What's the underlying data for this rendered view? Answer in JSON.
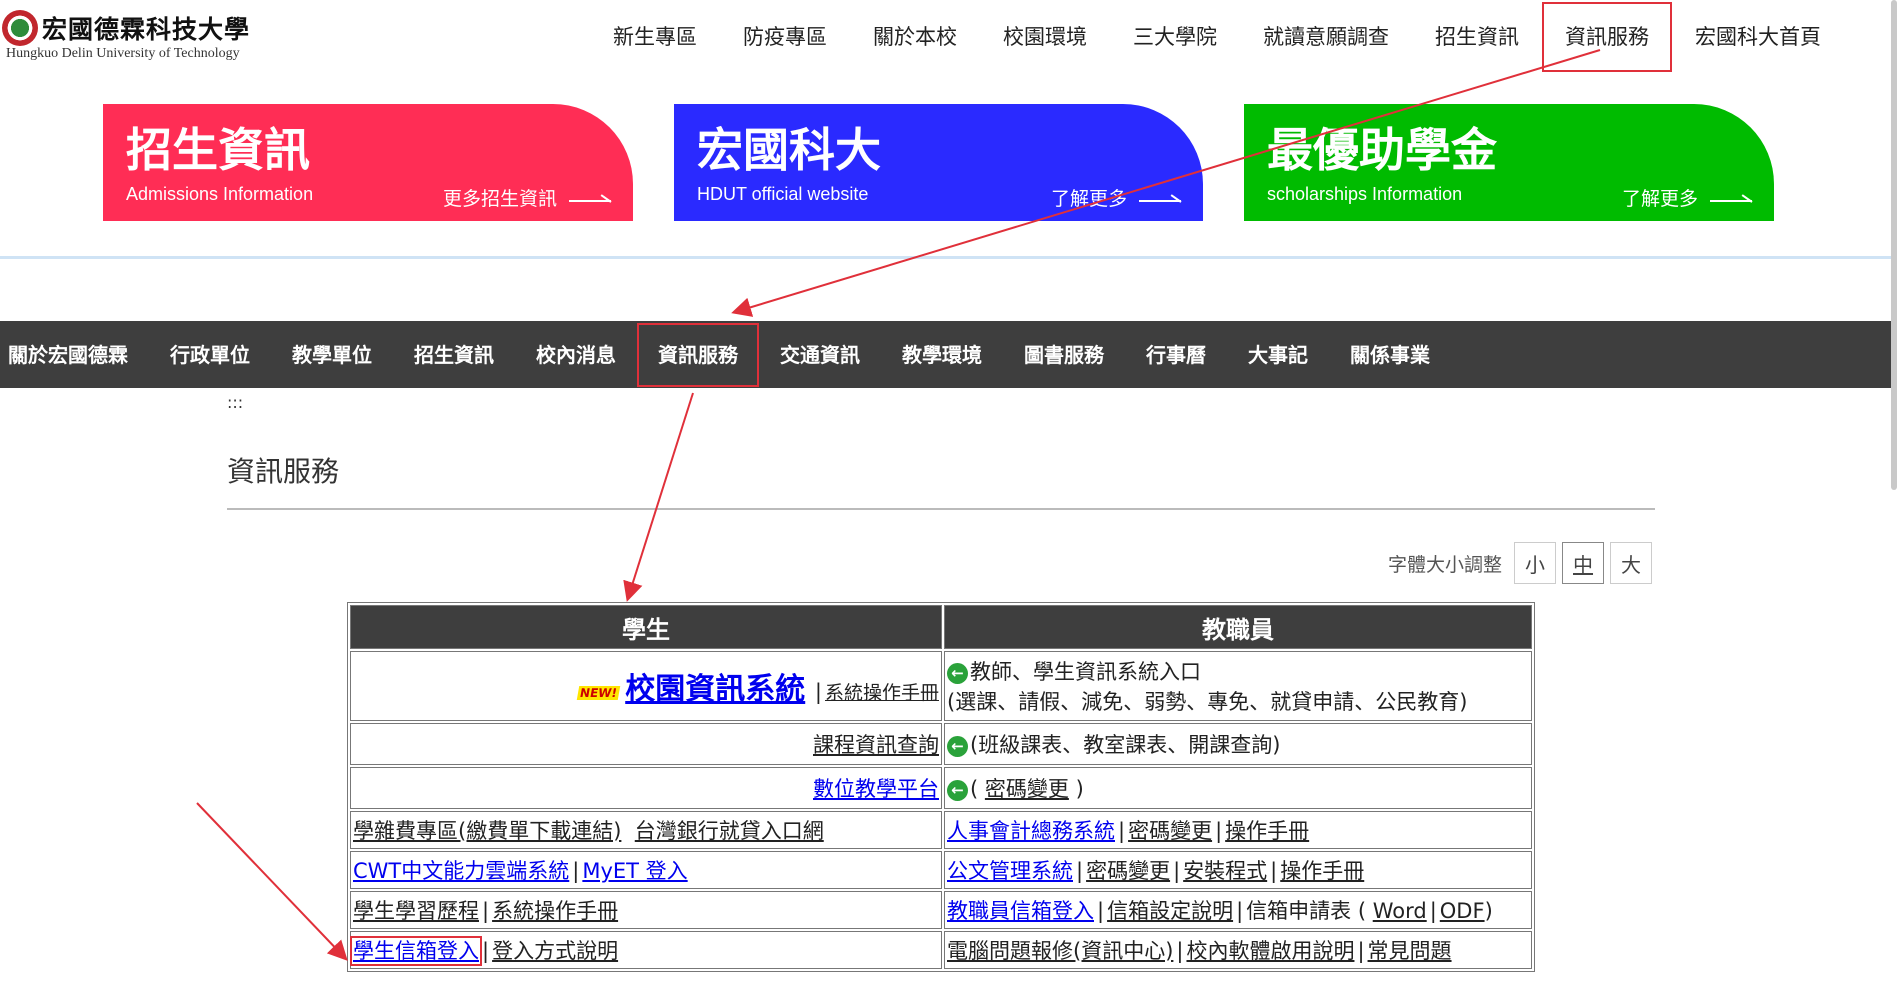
{
  "logo": {
    "name_cn": "宏國德霖科技大學",
    "name_en": "Hungkuo Delin University of Technology"
  },
  "top_nav": [
    "新生專區",
    "防疫專區",
    "關於本校",
    "校園環境",
    "三大學院",
    "就讀意願調查",
    "招生資訊",
    "資訊服務",
    "宏國科大首頁"
  ],
  "banners": [
    {
      "title": "招生資訊",
      "subtitle": "Admissions Information",
      "more": "更多招生資訊",
      "color": "#ff2d55"
    },
    {
      "title": "宏國科大",
      "subtitle": "HDUT official website",
      "more": "了解更多",
      "color": "#2a2aff"
    },
    {
      "title": "最優助學金",
      "subtitle": "scholarships Information",
      "more": "了解更多",
      "color": "#00bb00"
    }
  ],
  "gray_nav": [
    "關於宏國德霖",
    "行政單位",
    "教學單位",
    "招生資訊",
    "校內消息",
    "資訊服務",
    "交通資訊",
    "教學環境",
    "圖書服務",
    "行事曆",
    "大事記",
    "關係事業"
  ],
  "crumb": ":::",
  "page_title": "資訊服務",
  "font_size": {
    "label": "字體大小調整",
    "small": "小",
    "medium": "中",
    "large": "大"
  },
  "table": {
    "headers": {
      "students": "學生",
      "staff": "教職員"
    },
    "new_badge": "NEW!",
    "row1": {
      "campus_system": "校園資訊系統",
      "manual": "系統操作手冊",
      "staff_line1": "教師、學生資訊系統入口",
      "staff_line2": "(選課、請假、減免、弱勢、專免、就貸申請、公民教育)"
    },
    "row2": {
      "course": "課程資訊查詢",
      "desc": "(班級課表、教室課表、開課查詢)"
    },
    "row3": {
      "elearn": "數位教學平台",
      "open": "(",
      "pwd": "密碼變更",
      "close": ")"
    },
    "row4": {
      "fee": "學雜費專區(繳費單下載連結)",
      "bank": "台灣銀行就貸入口網",
      "accounting": "人事會計總務系統",
      "pwd": "密碼變更",
      "manual": "操作手冊"
    },
    "row5": {
      "cwt": "CWT中文能力雲端系統",
      "myet": "MyET 登入",
      "doc": "公文管理系統",
      "pwd": "密碼變更",
      "install": "安裝程式",
      "manual": "操作手冊"
    },
    "row6": {
      "portfolio": "學生學習歷程",
      "manual": "系統操作手冊",
      "staff_mail": "教職員信箱登入",
      "mail_setup": "信箱設定說明",
      "mail_apply": "信箱申請表 (",
      "word": "Word",
      "odf": "ODF",
      "close": ")"
    },
    "row7": {
      "student_mail": "學生信箱登入",
      "login_help": "登入方式說明",
      "repair": "電腦問題報修(資訊中心)",
      "software": "校內軟體啟用說明",
      "faq": "常見問題"
    },
    "sep": "|"
  },
  "colors": {
    "annotation": "#e0303a",
    "nav_bg": "#3e3e3e",
    "link": "#0000ee"
  }
}
